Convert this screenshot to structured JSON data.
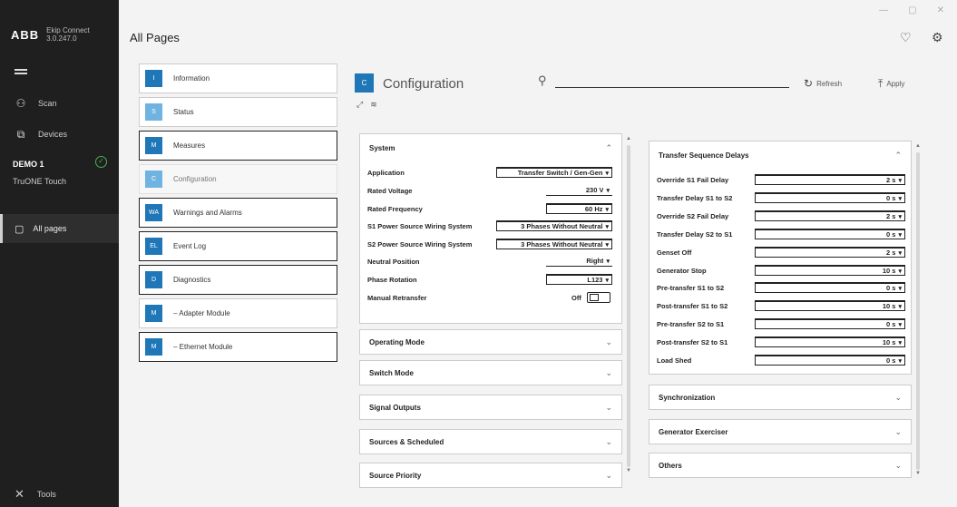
{
  "app": {
    "logo": "ABB",
    "name": "Ekip Connect",
    "version": "3.0.247.0",
    "window_controls": [
      "—",
      "▢",
      "✕"
    ]
  },
  "sidebar": {
    "scan_label": "Scan",
    "devices_label": "Devices",
    "device_name": "DEMO 1",
    "device_model": "TruONE Touch",
    "all_pages_label": "All pages",
    "tools_label": "Tools"
  },
  "header": {
    "title": "All Pages"
  },
  "pages": [
    {
      "code": "I",
      "label": "Information",
      "style": "normal"
    },
    {
      "code": "S",
      "label": "Status",
      "style": "normal"
    },
    {
      "code": "M",
      "label": "Measures",
      "style": "dark"
    },
    {
      "code": "C",
      "label": "Configuration",
      "style": "selected"
    },
    {
      "code": "WA",
      "label": "Warnings and Alarms",
      "style": "dark"
    },
    {
      "code": "EL",
      "label": "Event Log",
      "style": "dark"
    },
    {
      "code": "D",
      "label": "Diagnostics",
      "style": "dark"
    },
    {
      "code": "M",
      "label": "– Adapter Module",
      "style": "normal"
    },
    {
      "code": "M",
      "label": "– Ethernet Module",
      "style": "dark"
    }
  ],
  "config": {
    "tile": "C",
    "title": "Configuration",
    "search_placeholder": "",
    "refresh_label": "Refresh",
    "apply_label": "Apply"
  },
  "system_panel": {
    "title": "System",
    "fields": [
      {
        "label": "Application",
        "value": "Transfer Switch / Gen-Gen"
      },
      {
        "label": "Rated Voltage",
        "value": "230 V"
      },
      {
        "label": "Rated Frequency",
        "value": "60 Hz"
      },
      {
        "label": "S1 Power Source Wiring System",
        "value": "3 Phases Without Neutral"
      },
      {
        "label": "S2 Power Source Wiring System",
        "value": "3 Phases Without Neutral"
      },
      {
        "label": "Neutral Position",
        "value": "Right"
      },
      {
        "label": "Phase Rotation",
        "value": "L123"
      },
      {
        "label": "Manual Retransfer",
        "value": "Off"
      }
    ]
  },
  "collapsed_panels_left": [
    {
      "title": "Operating Mode"
    },
    {
      "title": "Switch Mode"
    },
    {
      "title": "Signal Outputs"
    },
    {
      "title": "Sources & Scheduled"
    },
    {
      "title": "Source Priority"
    }
  ],
  "transfer_panel": {
    "title": "Transfer Sequence Delays",
    "fields": [
      {
        "label": "Override S1 Fail Delay",
        "value": "2 s"
      },
      {
        "label": "Transfer Delay S1 to S2",
        "value": "0 s"
      },
      {
        "label": "Override S2 Fail Delay",
        "value": "2 s"
      },
      {
        "label": "Transfer Delay S2 to S1",
        "value": "0 s"
      },
      {
        "label": "Genset Off",
        "value": "2 s"
      },
      {
        "label": "Generator Stop",
        "value": "10 s"
      },
      {
        "label": "Pre-transfer S1 to S2",
        "value": "0 s"
      },
      {
        "label": "Post-transfer S1 to S2",
        "value": "10 s"
      },
      {
        "label": "Pre-transfer S2 to S1",
        "value": "0 s"
      },
      {
        "label": "Post-transfer S2 to S1",
        "value": "10 s"
      },
      {
        "label": "Load Shed",
        "value": "0 s"
      }
    ]
  },
  "collapsed_panels_right": [
    {
      "title": "Synchronization"
    },
    {
      "title": "Generator Exerciser"
    },
    {
      "title": "Others"
    }
  ]
}
